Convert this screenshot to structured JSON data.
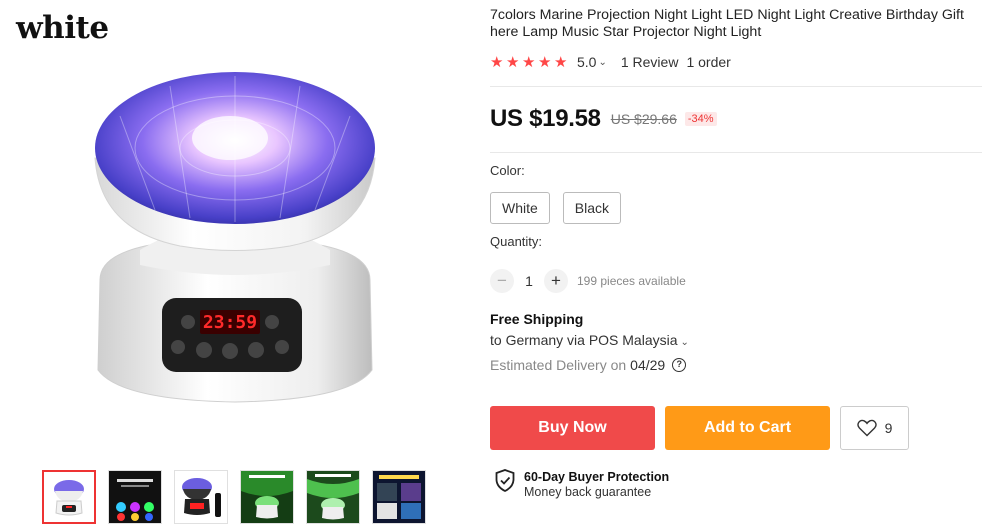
{
  "gallery": {
    "watermark": "white",
    "thumbnails": [
      {
        "name": "lamp-white-front"
      },
      {
        "name": "lamp-colors-grid"
      },
      {
        "name": "lamp-black-remote"
      },
      {
        "name": "lamp-green-adjustable-1"
      },
      {
        "name": "lamp-green-adjustable-2"
      },
      {
        "name": "lamp-gift-collage"
      }
    ],
    "display_time": "23:59"
  },
  "product": {
    "title": "7colors Marine Projection Night Light LED Night Light Creative Birthday Gift here Lamp Music Star Projector Night Light",
    "rating_value": "5.0",
    "reviews": "1 Review",
    "orders": "1 order",
    "price": "US $19.58",
    "old_price": "US $29.66",
    "discount": "-34%"
  },
  "options": {
    "color_label": "Color:",
    "colors": [
      "White",
      "Black"
    ],
    "quantity_label": "Quantity:",
    "quantity": "1",
    "available": "199 pieces available"
  },
  "shipping": {
    "title": "Free Shipping",
    "to": "to Germany via POS Malaysia",
    "delivery_prefix": "Estimated Delivery on",
    "delivery_date": "04/29"
  },
  "actions": {
    "buy_now": "Buy Now",
    "add_to_cart": "Add to Cart",
    "wishlist_count": "9"
  },
  "protection": {
    "title": "60-Day Buyer Protection",
    "subtitle": "Money back guarantee"
  },
  "colors": {
    "accent_red": "#f04a4a",
    "accent_orange": "#ff9a17",
    "star": "#ff4747"
  }
}
